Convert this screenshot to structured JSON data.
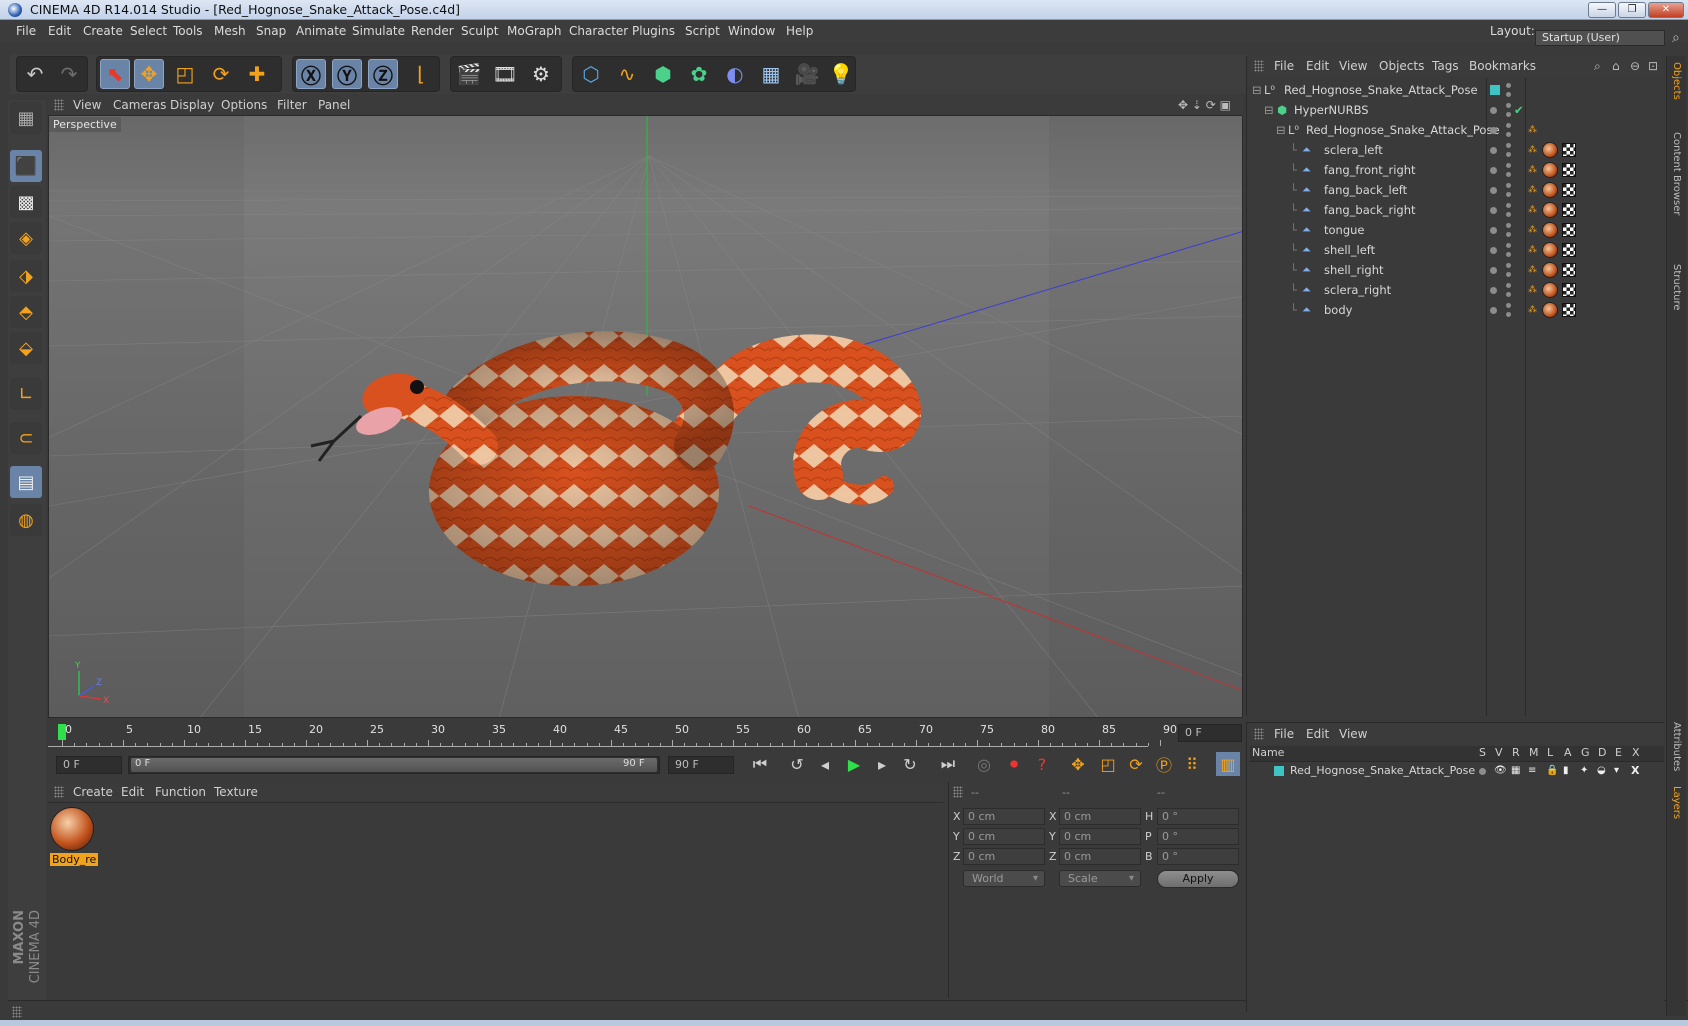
{
  "window": {
    "title": "CINEMA 4D R14.014 Studio - [Red_Hognose_Snake_Attack_Pose.c4d]",
    "minimize": "—",
    "restore": "❐",
    "close": "✕"
  },
  "menu": [
    "File",
    "Edit",
    "Create",
    "Select",
    "Tools",
    "Mesh",
    "Snap",
    "Animate",
    "Simulate",
    "Render",
    "Sculpt",
    "MoGraph",
    "Character",
    "Plugins",
    "Script",
    "Window",
    "Help"
  ],
  "layout": {
    "label": "Layout:",
    "value": "Startup (User)"
  },
  "viewport": {
    "menu": [
      "View",
      "Cameras",
      "Display",
      "Options",
      "Filter",
      "Panel"
    ],
    "label": "Perspective",
    "axis_y": "Y",
    "axis_x": "X",
    "axis_z": "Z"
  },
  "timeline": {
    "ticks": [
      "0",
      "5",
      "10",
      "15",
      "20",
      "25",
      "30",
      "35",
      "40",
      "45",
      "50",
      "55",
      "60",
      "65",
      "70",
      "75",
      "80",
      "85",
      "90"
    ],
    "current_frame": "0 F",
    "start_field": "0 F",
    "range_start": "0 F",
    "range_end": "90 F",
    "end_field": "90 F"
  },
  "material_manager": {
    "menu": [
      "Create",
      "Edit",
      "Function",
      "Texture"
    ],
    "material_name": "Body_re"
  },
  "coordinates": {
    "headers": [
      "--",
      "--",
      "--"
    ],
    "rows": [
      {
        "l1": "X",
        "v1": "0 cm",
        "l2": "X",
        "v2": "0 cm",
        "l3": "H",
        "v3": "0 °"
      },
      {
        "l1": "Y",
        "v1": "0 cm",
        "l2": "Y",
        "v2": "0 cm",
        "l3": "P",
        "v3": "0 °"
      },
      {
        "l1": "Z",
        "v1": "0 cm",
        "l2": "Z",
        "v2": "0 cm",
        "l3": "B",
        "v3": "0 °"
      }
    ],
    "mode": "World",
    "scale": "Scale",
    "apply": "Apply"
  },
  "object_manager": {
    "menu": [
      "File",
      "Edit",
      "View",
      "Objects",
      "Tags",
      "Bookmarks"
    ],
    "items": [
      {
        "name": "Red_Hognose_Snake_Attack_Pose",
        "level": 0
      },
      {
        "name": "HyperNURBS",
        "level": 1
      },
      {
        "name": "Red_Hognose_Snake_Attack_Pose",
        "level": 2
      },
      {
        "name": "sclera_left",
        "level": 3
      },
      {
        "name": "fang_front_right",
        "level": 3
      },
      {
        "name": "fang_back_left",
        "level": 3
      },
      {
        "name": "fang_back_right",
        "level": 3
      },
      {
        "name": "tongue",
        "level": 3
      },
      {
        "name": "shell_left",
        "level": 3
      },
      {
        "name": "shell_right",
        "level": 3
      },
      {
        "name": "sclera_right",
        "level": 3
      },
      {
        "name": "body",
        "level": 3
      }
    ]
  },
  "layer_manager": {
    "menu": [
      "File",
      "Edit",
      "View"
    ],
    "columns": [
      "Name",
      "S",
      "V",
      "R",
      "M",
      "L",
      "A",
      "G",
      "D",
      "E",
      "X"
    ],
    "layer_name": "Red_Hognose_Snake_Attack_Pose"
  },
  "side_tabs": [
    "Objects",
    "Content Browser",
    "Structure",
    "Attributes",
    "Layers"
  ],
  "brand": {
    "maxon": "MAXON",
    "product": "CINEMA 4D"
  },
  "colors": {
    "accent": "#6a84a8",
    "layer": "#3ec4c4",
    "bg": "#3a3a3a"
  }
}
